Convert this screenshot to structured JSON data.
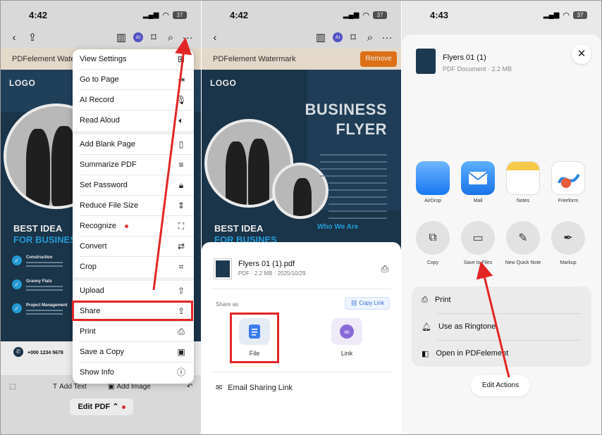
{
  "panel1": {
    "status": {
      "time": "4:42",
      "battery": "37"
    },
    "toolbar": {
      "ai": "AI"
    },
    "watermark": {
      "text": "PDFelement Waterm"
    },
    "doc": {
      "logo": "LOGO",
      "best1": "BEST IDEA",
      "best2": "FOR BUSINES",
      "bullets": [
        "Construction",
        "Granny Flats",
        "Project Management"
      ],
      "phone": "+000 1234 5678"
    },
    "bottom": {
      "add_text": "Add Text",
      "add_image": "Add Image"
    },
    "edit_pdf": "Edit PDF",
    "menu": {
      "items": [
        {
          "label": "View Settings",
          "icon": "view-settings-icon"
        },
        {
          "label": "Go to Page",
          "icon": "go-to-page-icon"
        },
        {
          "label": "AI Record",
          "icon": "microphone-icon"
        },
        {
          "label": "Read Aloud",
          "icon": "speaker-icon"
        },
        {
          "label": "Add Blank Page",
          "icon": "blank-page-icon"
        },
        {
          "label": "Summarize PDF",
          "icon": "summarize-icon"
        },
        {
          "label": "Set Password",
          "icon": "lock-icon"
        },
        {
          "label": "Reduce File Size",
          "icon": "compress-icon"
        },
        {
          "label": "Recognize",
          "icon": "scan-text-icon"
        },
        {
          "label": "Convert",
          "icon": "convert-icon"
        },
        {
          "label": "Crop",
          "icon": "crop-icon"
        },
        {
          "label": "Upload",
          "icon": "upload-icon"
        },
        {
          "label": "Share",
          "icon": "share-icon"
        },
        {
          "label": "Print",
          "icon": "printer-icon"
        },
        {
          "label": "Save a Copy",
          "icon": "save-icon"
        },
        {
          "label": "Show Info",
          "icon": "info-icon"
        }
      ]
    }
  },
  "panel2": {
    "status": {
      "time": "4:42",
      "battery": "37"
    },
    "toolbar": {
      "ai": "AI"
    },
    "watermark": {
      "text": "PDFelement Watermark",
      "remove": "Remove"
    },
    "doc": {
      "logo": "LOGO",
      "title1": "BUSINESS",
      "title2": "FLYER",
      "best1": "BEST IDEA",
      "best2": "FOR BUSINES",
      "who": "Who We Are"
    },
    "sheet": {
      "file_name": "Flyers 01 (1).pdf",
      "file_meta": "PDF · 2.2 MB · 2025/10/29",
      "share_as": "Share as",
      "copy_link": "Copy Link",
      "file_label": "File",
      "link_label": "Link",
      "email_link": "Email Sharing Link"
    }
  },
  "panel3": {
    "status": {
      "time": "4:43",
      "battery": "37"
    },
    "sheet": {
      "file_name": "Flyers 01 (1)",
      "file_meta": "PDF Document · 2.2 MB",
      "apps": [
        {
          "label": "AirDrop",
          "icon": "airdrop-icon"
        },
        {
          "label": "Mail",
          "icon": "mail-icon"
        },
        {
          "label": "Notes",
          "icon": "notes-icon"
        },
        {
          "label": "Freeform",
          "icon": "freeform-icon"
        }
      ],
      "actions": [
        {
          "label": "Copy",
          "icon": "copy-icon"
        },
        {
          "label": "Save to Files",
          "icon": "folder-icon"
        },
        {
          "label": "New Quick Note",
          "icon": "quick-note-icon"
        },
        {
          "label": "Markup",
          "icon": "markup-icon"
        }
      ],
      "list": [
        {
          "label": "Print",
          "icon": "printer-icon"
        },
        {
          "label": "Use as Ringtone",
          "icon": "bell-icon"
        },
        {
          "label": "Open in PDFelement",
          "icon": "pdfelement-icon"
        }
      ],
      "edit_actions": "Edit Actions"
    }
  },
  "colors": {
    "accent_red": "#e32525",
    "orange": "#f07a1a",
    "navy": "#1d3950",
    "link_blue": "#2b67d8"
  }
}
